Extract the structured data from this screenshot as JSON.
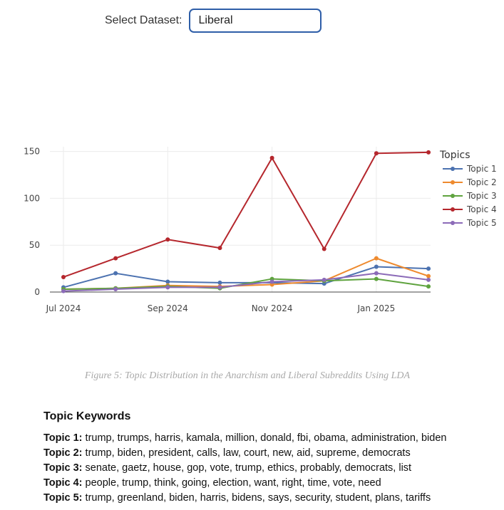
{
  "dataset_selector": {
    "label": "Select Dataset:",
    "value": "Liberal"
  },
  "chart_data": {
    "type": "line",
    "x": [
      "2024-07-01",
      "2024-08-01",
      "2024-09-01",
      "2024-10-01",
      "2024-11-01",
      "2024-12-01",
      "2025-01-01",
      "2025-02-01"
    ],
    "xticks": [
      "Jul 2024",
      "Sep 2024",
      "Nov 2024",
      "Jan 2025"
    ],
    "yticks": [
      "0",
      "50",
      "100",
      "150"
    ],
    "ylim": [
      0,
      155
    ],
    "grid": true,
    "legend_title": "Topics",
    "legend_position": "right",
    "series": [
      {
        "name": "Topic 1",
        "color": "#4c72b0",
        "values": [
          5,
          20,
          11,
          10,
          10,
          9,
          27,
          25
        ]
      },
      {
        "name": "Topic 2",
        "color": "#ee8a2e",
        "values": [
          3,
          4,
          7,
          6,
          8,
          12,
          36,
          17
        ]
      },
      {
        "name": "Topic 3",
        "color": "#5fa33f",
        "values": [
          3,
          4,
          6,
          4,
          14,
          12,
          14,
          6
        ]
      },
      {
        "name": "Topic 4",
        "color": "#b5272d",
        "values": [
          16,
          36,
          56,
          47,
          143,
          46,
          148,
          149
        ]
      },
      {
        "name": "Topic 5",
        "color": "#8c6bb8",
        "values": [
          1,
          3,
          5,
          5,
          11,
          13,
          20,
          13
        ]
      }
    ]
  },
  "caption": "Figure 5: Topic Distribution in the Anarchism and Liberal Subreddits Using LDA",
  "keywords": {
    "heading": "Topic Keywords",
    "items": [
      {
        "topic": "Topic 1:",
        "words": "trump, trumps, harris, kamala, million, donald, fbi, obama, administration, biden"
      },
      {
        "topic": "Topic 2:",
        "words": "trump, biden, president, calls, law, court, new, aid, supreme, democrats"
      },
      {
        "topic": "Topic 3:",
        "words": "senate, gaetz, house, gop, vote, trump, ethics, probably, democrats, list"
      },
      {
        "topic": "Topic 4:",
        "words": "people, trump, think, going, election, want, right, time, vote, need"
      },
      {
        "topic": "Topic 5:",
        "words": "trump, greenland, biden, harris, bidens, says, security, student, plans, tariffs"
      }
    ]
  }
}
